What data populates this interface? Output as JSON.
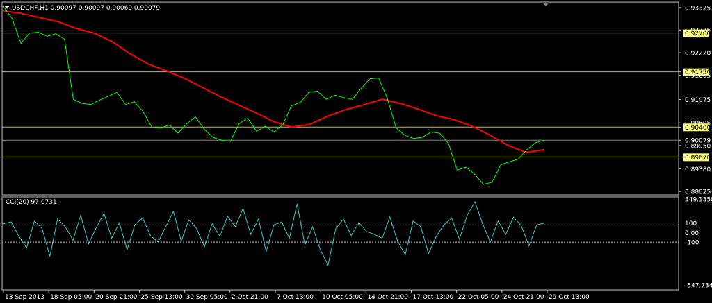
{
  "window": {
    "title": "USDCHF,H1  0.90097 0.90097 0.90069 0.90079",
    "menu_icon": "triangle-down-icon"
  },
  "indicator": {
    "label": "CCI(20) 97.0731"
  },
  "colors": {
    "background": "#000000",
    "frame": "#c0c0c0",
    "price_line": "#00ff00",
    "ma_line": "#ff0000",
    "level_line": "#c8c800",
    "cci_line": "#40c8c8",
    "current_price": "#808080"
  },
  "chart_data": [
    {
      "type": "line",
      "title": "USDCHF,H1",
      "x": [
        "13 Sep 2013",
        "18 Sep 05:00",
        "20 Sep 21:00",
        "25 Sep 13:00",
        "30 Sep 05:00",
        "2 Oct 21:00",
        "7 Oct 13:00",
        "10 Oct 05:00",
        "14 Oct 21:00",
        "17 Oct 13:00",
        "22 Oct 05:00",
        "24 Oct 21:00",
        "29 Oct 13:00"
      ],
      "y_axis_ticks": [
        "0.93325",
        "0.92775",
        "0.92700",
        "0.92220",
        "0.91750",
        "0.91665",
        "0.91075",
        "0.90505",
        "0.90400",
        "0.90079",
        "0.89950",
        "0.89670",
        "0.89380",
        "0.88825"
      ],
      "ylim": [
        0.8876,
        0.9344
      ],
      "price_levels": [
        "0.92700",
        "0.91750",
        "0.90400",
        "0.89670"
      ],
      "current_price": "0.90079",
      "series": [
        {
          "values": [
            0.9335,
            0.9305,
            0.9245,
            0.927,
            0.9272,
            0.9262,
            0.9268,
            0.9255,
            0.9108,
            0.9098,
            0.9095,
            0.9106,
            0.9115,
            0.9125,
            0.9095,
            0.9102,
            0.9078,
            0.904,
            0.9038,
            0.9045,
            0.9025,
            0.9048,
            0.9065,
            0.9035,
            0.9015,
            0.9008,
            0.9005,
            0.9048,
            0.9062,
            0.903,
            0.9042,
            0.9028,
            0.9045,
            0.9092,
            0.91,
            0.9125,
            0.9128,
            0.9108,
            0.9118,
            0.9112,
            0.9108,
            0.9135,
            0.9158,
            0.916,
            0.911,
            0.9038,
            0.902,
            0.9012,
            0.9015,
            0.9028,
            0.9025,
            0.9,
            0.8935,
            0.8942,
            0.8925,
            0.89,
            0.8905,
            0.8948,
            0.8955,
            0.8962,
            0.8985,
            0.9002,
            0.9008
          ]
        },
        {
          "values": [
            0.9324,
            0.9318,
            0.9308,
            0.9298,
            0.9282,
            0.927,
            0.925,
            0.922,
            0.9195,
            0.9178,
            0.916,
            0.9138,
            0.9115,
            0.9095,
            0.9075,
            0.9053,
            0.904,
            0.9047,
            0.9067,
            0.9083,
            0.9095,
            0.9108,
            0.9098,
            0.9084,
            0.9068,
            0.9058,
            0.9042,
            0.902,
            0.8995,
            0.8978,
            0.8985
          ]
        }
      ]
    },
    {
      "type": "line",
      "title": "CCI(20) 97.0731",
      "x": [
        "13 Sep 2013",
        "18 Sep 05:00",
        "20 Sep 21:00",
        "25 Sep 13:00",
        "30 Sep 05:00",
        "2 Oct 21:00",
        "7 Oct 13:00",
        "10 Oct 05:00",
        "14 Oct 21:00",
        "17 Oct 13:00",
        "22 Oct 05:00",
        "24 Oct 21:00",
        "29 Oct 13:00"
      ],
      "y_axis_ticks": [
        "349.1358",
        "100",
        "0.00",
        "-100",
        "-547.7342"
      ],
      "ylim": [
        -547.7342,
        349.1358
      ],
      "levels": [
        100,
        -100
      ],
      "series": [
        {
          "values": [
            90,
            110,
            -40,
            -160,
            120,
            40,
            -250,
            140,
            60,
            -80,
            180,
            -120,
            50,
            200,
            -60,
            100,
            -180,
            80,
            150,
            -30,
            -100,
            60,
            220,
            -90,
            130,
            40,
            -150,
            90,
            -40,
            170,
            60,
            250,
            -20,
            140,
            -200,
            80,
            110,
            -60,
            300,
            -130,
            60,
            -180,
            -340,
            40,
            140,
            -30,
            100,
            10,
            -20,
            -60,
            160,
            -90,
            -230,
            120,
            60,
            -220,
            -40,
            80,
            150,
            -70,
            180,
            320,
            90,
            -100,
            120,
            -20,
            160,
            70,
            -140,
            80,
            98
          ]
        }
      ]
    }
  ]
}
